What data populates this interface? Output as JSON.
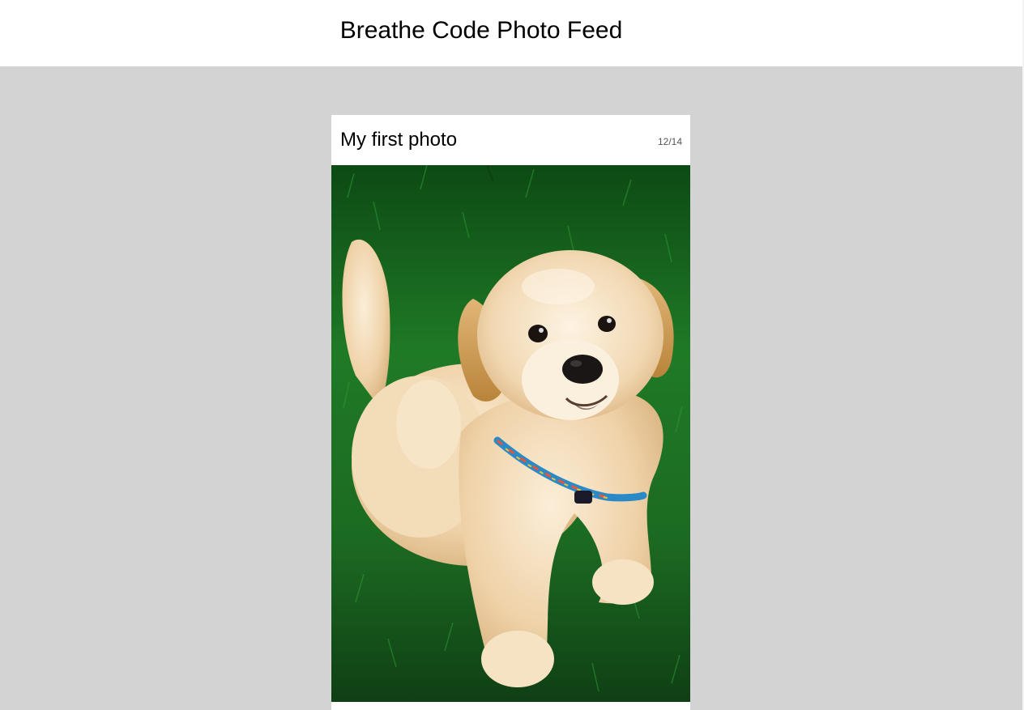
{
  "header": {
    "title": "Breathe Code Photo Feed"
  },
  "feed": {
    "posts": [
      {
        "title": "My first photo",
        "counter": "12/14",
        "image_subject": "golden-retriever-puppy"
      }
    ]
  },
  "colors": {
    "page_background": "#d3d3d3",
    "header_background": "#ffffff",
    "card_background": "#ffffff",
    "grass": "#1f6b25",
    "puppy_fur": "#eccfa6"
  }
}
